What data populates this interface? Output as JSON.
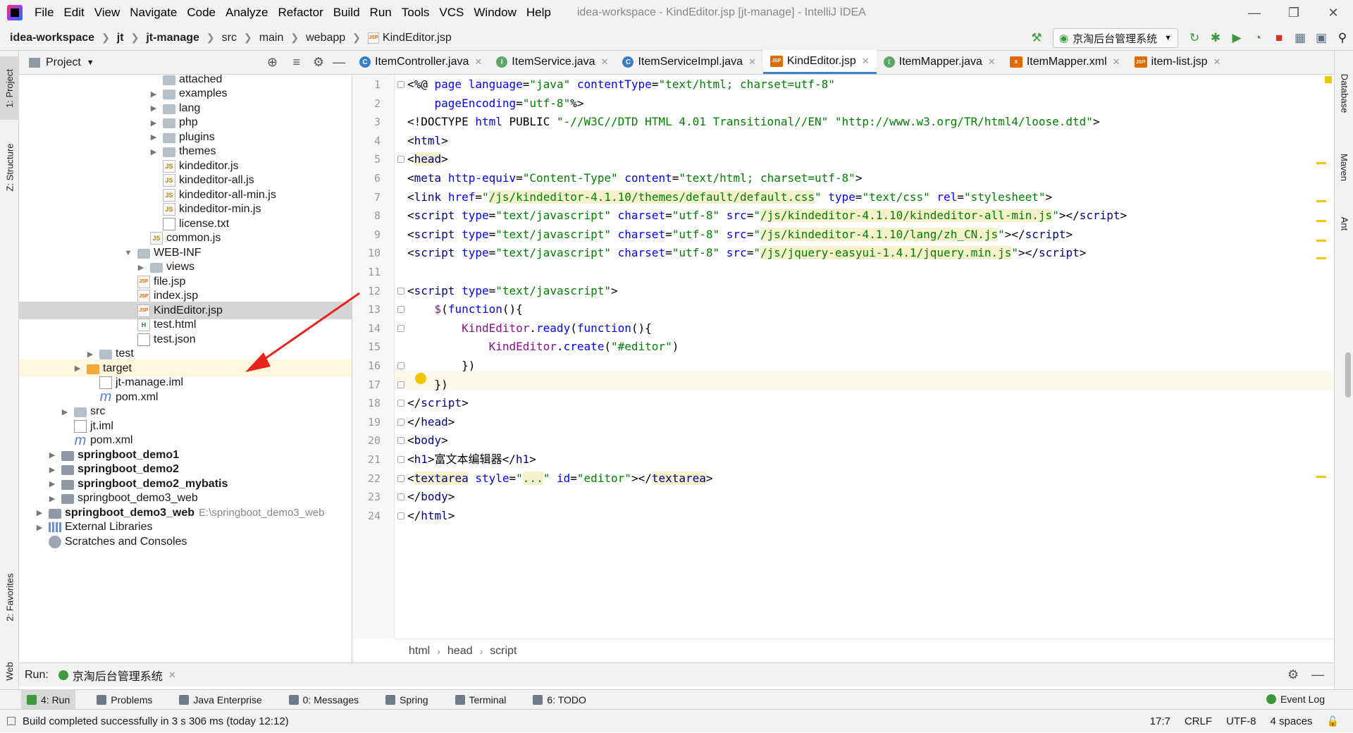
{
  "menu": {
    "items": [
      "File",
      "Edit",
      "View",
      "Navigate",
      "Code",
      "Analyze",
      "Refactor",
      "Build",
      "Run",
      "Tools",
      "VCS",
      "Window",
      "Help"
    ],
    "title": "idea-workspace - KindEditor.jsp [jt-manage] - IntelliJ IDEA"
  },
  "nav": {
    "crumbs": [
      "idea-workspace",
      "jt",
      "jt-manage",
      "src",
      "main",
      "webapp",
      "KindEditor.jsp"
    ],
    "run_config": "京淘后台管理系统"
  },
  "side_tabs": {
    "project": "1: Project",
    "structure": "Z: Structure",
    "favorites": "2: Favorites",
    "web": "Web",
    "database": "Database",
    "maven": "Maven",
    "ant": "Ant"
  },
  "project_panel": {
    "title": "Project",
    "tree": [
      {
        "label": "attached",
        "type": "folder",
        "indent": 3,
        "arrow": ""
      },
      {
        "label": "examples",
        "type": "folder",
        "indent": 3,
        "arrow": "right"
      },
      {
        "label": "lang",
        "type": "folder",
        "indent": 3,
        "arrow": "right"
      },
      {
        "label": "php",
        "type": "folder",
        "indent": 3,
        "arrow": "right"
      },
      {
        "label": "plugins",
        "type": "folder",
        "indent": 3,
        "arrow": "right"
      },
      {
        "label": "themes",
        "type": "folder",
        "indent": 3,
        "arrow": "right"
      },
      {
        "label": "kindeditor.js",
        "type": "js",
        "indent": 3,
        "arrow": ""
      },
      {
        "label": "kindeditor-all.js",
        "type": "js",
        "indent": 3,
        "arrow": ""
      },
      {
        "label": "kindeditor-all-min.js",
        "type": "js",
        "indent": 3,
        "arrow": ""
      },
      {
        "label": "kindeditor-min.js",
        "type": "js",
        "indent": 3,
        "arrow": ""
      },
      {
        "label": "license.txt",
        "type": "txt",
        "indent": 3,
        "arrow": ""
      },
      {
        "label": "common.js",
        "type": "js",
        "indent": 2,
        "arrow": ""
      },
      {
        "label": "WEB-INF",
        "type": "folder",
        "indent": 1,
        "arrow": "down"
      },
      {
        "label": "views",
        "type": "folder",
        "indent": 2,
        "arrow": "right"
      },
      {
        "label": "file.jsp",
        "type": "jsp",
        "indent": 1,
        "arrow": ""
      },
      {
        "label": "index.jsp",
        "type": "jsp",
        "indent": 1,
        "arrow": ""
      },
      {
        "label": "KindEditor.jsp",
        "type": "jsp",
        "indent": 1,
        "arrow": "",
        "selected": true
      },
      {
        "label": "test.html",
        "type": "html",
        "indent": 1,
        "arrow": ""
      },
      {
        "label": "test.json",
        "type": "txt",
        "indent": 1,
        "arrow": ""
      },
      {
        "label": "test",
        "type": "folder",
        "indent": -2,
        "arrow": "right"
      },
      {
        "label": "target",
        "type": "folder-orange",
        "indent": -3,
        "arrow": "right",
        "excluded": true
      },
      {
        "label": "jt-manage.iml",
        "type": "txt",
        "indent": -2,
        "arrow": ""
      },
      {
        "label": "pom.xml",
        "type": "m",
        "indent": -2,
        "arrow": ""
      },
      {
        "label": "src",
        "type": "folder",
        "indent": -4,
        "arrow": "right"
      },
      {
        "label": "jt.iml",
        "type": "txt",
        "indent": -4,
        "arrow": ""
      },
      {
        "label": "pom.xml",
        "type": "m",
        "indent": -4,
        "arrow": ""
      },
      {
        "label": "springboot_demo1",
        "type": "module",
        "indent": -5,
        "arrow": "right",
        "bold": true
      },
      {
        "label": "springboot_demo2",
        "type": "module",
        "indent": -5,
        "arrow": "right",
        "bold": true
      },
      {
        "label": "springboot_demo2_mybatis",
        "type": "module",
        "indent": -5,
        "arrow": "right",
        "bold": true
      },
      {
        "label": "springboot_demo3_web",
        "type": "module",
        "indent": -5,
        "arrow": "right"
      },
      {
        "label": "springboot_demo3_web",
        "type": "module",
        "indent": -6,
        "arrow": "right",
        "bold": true,
        "extra": "E:\\springboot_demo3_web"
      },
      {
        "label": "External Libraries",
        "type": "lib",
        "indent": -6,
        "arrow": "right"
      },
      {
        "label": "Scratches and Consoles",
        "type": "scratch",
        "indent": -6,
        "arrow": ""
      }
    ]
  },
  "tabs": [
    {
      "label": "ItemController.java",
      "icon": "C",
      "color": "#3a7fc4"
    },
    {
      "label": "ItemService.java",
      "icon": "I",
      "color": "#59a869"
    },
    {
      "label": "ItemServiceImpl.java",
      "icon": "C",
      "color": "#3a7fc4"
    },
    {
      "label": "KindEditor.jsp",
      "icon": "JSP",
      "color": "#e06c00",
      "active": true
    },
    {
      "label": "ItemMapper.java",
      "icon": "I",
      "color": "#59a869"
    },
    {
      "label": "ItemMapper.xml",
      "icon": "X",
      "color": "#e06c00"
    },
    {
      "label": "item-list.jsp",
      "icon": "JSP",
      "color": "#e06c00"
    }
  ],
  "code": [
    [
      [
        "dir",
        "<%@ "
      ],
      [
        "attr",
        "page "
      ],
      [
        "attr",
        "language"
      ],
      [
        "punc",
        "="
      ],
      [
        "str",
        "\"java\" "
      ],
      [
        "attr",
        "contentType"
      ],
      [
        "punc",
        "="
      ],
      [
        "str",
        "\"text/html; charset=utf-8\""
      ]
    ],
    [
      [
        "punc",
        "    "
      ],
      [
        "attr",
        "pageEncoding"
      ],
      [
        "punc",
        "="
      ],
      [
        "str",
        "\"utf-8\""
      ],
      [
        "punc",
        "%>"
      ]
    ],
    [
      [
        "punc",
        "<!DOCTYPE "
      ],
      [
        "attr",
        "html "
      ],
      [
        "punc",
        "PUBLIC "
      ],
      [
        "str",
        "\"-//W3C//DTD HTML 4.01 Transitional//EN\" \"http://www.w3.org/TR/html4/loose.dtd\""
      ],
      [
        "punc",
        ">"
      ]
    ],
    [
      [
        "punc",
        "<"
      ],
      [
        "tag",
        "html"
      ],
      [
        "punc",
        ">"
      ]
    ],
    [
      [
        "punc",
        "<"
      ],
      [
        "taghl",
        "head"
      ],
      [
        "punc",
        ">"
      ]
    ],
    [
      [
        "punc",
        "<"
      ],
      [
        "tag",
        "meta "
      ],
      [
        "attr",
        "http-equiv"
      ],
      [
        "punc",
        "="
      ],
      [
        "str",
        "\"Content-Type\" "
      ],
      [
        "attr",
        "content"
      ],
      [
        "punc",
        "="
      ],
      [
        "str",
        "\"text/html; charset=utf-8\""
      ],
      [
        "punc",
        ">"
      ]
    ],
    [
      [
        "punc",
        "<"
      ],
      [
        "tag",
        "link "
      ],
      [
        "attr",
        "href"
      ],
      [
        "punc",
        "="
      ],
      [
        "str",
        "\""
      ],
      [
        "strhl",
        "/js/kindeditor-4.1.10/themes/default/default.css"
      ],
      [
        "str",
        "\" "
      ],
      [
        "attr",
        "type"
      ],
      [
        "punc",
        "="
      ],
      [
        "str",
        "\"text/css\" "
      ],
      [
        "attr",
        "rel"
      ],
      [
        "punc",
        "="
      ],
      [
        "str",
        "\"stylesheet\""
      ],
      [
        "punc",
        ">"
      ]
    ],
    [
      [
        "punc",
        "<"
      ],
      [
        "tag",
        "script "
      ],
      [
        "attr",
        "type"
      ],
      [
        "punc",
        "="
      ],
      [
        "str",
        "\"text/javascript\" "
      ],
      [
        "attr",
        "charset"
      ],
      [
        "punc",
        "="
      ],
      [
        "str",
        "\"utf-8\" "
      ],
      [
        "attr",
        "src"
      ],
      [
        "punc",
        "="
      ],
      [
        "str",
        "\""
      ],
      [
        "strhl",
        "/js/kindeditor-4.1.10/kindeditor-all-min.js"
      ],
      [
        "str",
        "\""
      ],
      [
        "punc",
        "></"
      ],
      [
        "tag",
        "script"
      ],
      [
        "punc",
        ">"
      ]
    ],
    [
      [
        "punc",
        "<"
      ],
      [
        "tag",
        "script "
      ],
      [
        "attr",
        "type"
      ],
      [
        "punc",
        "="
      ],
      [
        "str",
        "\"text/javascript\" "
      ],
      [
        "attr",
        "charset"
      ],
      [
        "punc",
        "="
      ],
      [
        "str",
        "\"utf-8\" "
      ],
      [
        "attr",
        "src"
      ],
      [
        "punc",
        "="
      ],
      [
        "str",
        "\""
      ],
      [
        "strhl",
        "/js/kindeditor-4.1.10/lang/zh_CN.js"
      ],
      [
        "str",
        "\""
      ],
      [
        "punc",
        "></"
      ],
      [
        "tag",
        "script"
      ],
      [
        "punc",
        ">"
      ]
    ],
    [
      [
        "punc",
        "<"
      ],
      [
        "tag",
        "script "
      ],
      [
        "attr",
        "type"
      ],
      [
        "punc",
        "="
      ],
      [
        "str",
        "\"text/javascript\" "
      ],
      [
        "attr",
        "charset"
      ],
      [
        "punc",
        "="
      ],
      [
        "str",
        "\"utf-8\" "
      ],
      [
        "attr",
        "src"
      ],
      [
        "punc",
        "="
      ],
      [
        "str",
        "\""
      ],
      [
        "strhl",
        "/js/jquery-easyui-1.4.1/jquery.min.js"
      ],
      [
        "str",
        "\""
      ],
      [
        "punc",
        "></"
      ],
      [
        "tag",
        "script"
      ],
      [
        "punc",
        ">"
      ]
    ],
    [],
    [
      [
        "punc",
        "<"
      ],
      [
        "tag",
        "script "
      ],
      [
        "attr",
        "type"
      ],
      [
        "punc",
        "="
      ],
      [
        "str",
        "\"text/javascript\""
      ],
      [
        "punc",
        ">"
      ]
    ],
    [
      [
        "punc",
        "    "
      ],
      [
        "fn",
        "$"
      ],
      [
        "punc",
        "("
      ],
      [
        "attr",
        "function"
      ],
      [
        "punc",
        "(){"
      ]
    ],
    [
      [
        "punc",
        "        "
      ],
      [
        "fn",
        "KindEditor"
      ],
      [
        "punc",
        "."
      ],
      [
        "attr",
        "ready"
      ],
      [
        "punc",
        "("
      ],
      [
        "attr",
        "function"
      ],
      [
        "punc",
        "(){"
      ]
    ],
    [
      [
        "punc",
        "            "
      ],
      [
        "fn",
        "KindEditor"
      ],
      [
        "punc",
        "."
      ],
      [
        "attr",
        "create"
      ],
      [
        "punc",
        "("
      ],
      [
        "str",
        "\"#editor\""
      ],
      [
        "punc",
        ")"
      ]
    ],
    [
      [
        "punc",
        "        })"
      ]
    ],
    [
      [
        "punc",
        "    })"
      ]
    ],
    [
      [
        "punc",
        "</"
      ],
      [
        "tag",
        "script"
      ],
      [
        "punc",
        ">"
      ]
    ],
    [
      [
        "punc",
        "</"
      ],
      [
        "tag",
        "head"
      ],
      [
        "punc",
        ">"
      ]
    ],
    [
      [
        "punc",
        "<"
      ],
      [
        "tag",
        "body"
      ],
      [
        "punc",
        ">"
      ]
    ],
    [
      [
        "punc",
        "<"
      ],
      [
        "tag",
        "h1"
      ],
      [
        "punc",
        ">富文本编辑器</"
      ],
      [
        "tag",
        "h1"
      ],
      [
        "punc",
        ">"
      ]
    ],
    [
      [
        "punc",
        "<"
      ],
      [
        "taghl",
        "textarea"
      ],
      [
        "punc",
        " "
      ],
      [
        "attr",
        "style"
      ],
      [
        "punc",
        "="
      ],
      [
        "str",
        "\""
      ],
      [
        "strhl",
        "..."
      ],
      [
        "str",
        "\" "
      ],
      [
        "attr",
        "id"
      ],
      [
        "punc",
        "="
      ],
      [
        "str",
        "\"editor\""
      ],
      [
        "punc",
        "></"
      ],
      [
        "taghl",
        "textarea"
      ],
      [
        "punc",
        ">"
      ]
    ],
    [
      [
        "punc",
        "</"
      ],
      [
        "tag",
        "body"
      ],
      [
        "punc",
        ">"
      ]
    ],
    [
      [
        "punc",
        "</"
      ],
      [
        "tag",
        "html"
      ],
      [
        "punc",
        ">"
      ]
    ]
  ],
  "editor_breadcrumb": [
    "html",
    "head",
    "script"
  ],
  "run_bar": {
    "label": "Run:",
    "config": "京淘后台管理系统"
  },
  "bottom_tabs": [
    {
      "label": "4: Run",
      "active": true
    },
    {
      "label": "Problems"
    },
    {
      "label": "Java Enterprise"
    },
    {
      "label": "0: Messages"
    },
    {
      "label": "Spring"
    },
    {
      "label": "Terminal"
    },
    {
      "label": "6: TODO"
    }
  ],
  "event_log": "Event Log",
  "status": {
    "message": "Build completed successfully in 3 s 306 ms (today 12:12)",
    "position": "17:7",
    "line_sep": "CRLF",
    "encoding": "UTF-8",
    "indent": "4 spaces"
  },
  "colors": {
    "accent": "#4083c9",
    "arrow": "#e8231e"
  }
}
